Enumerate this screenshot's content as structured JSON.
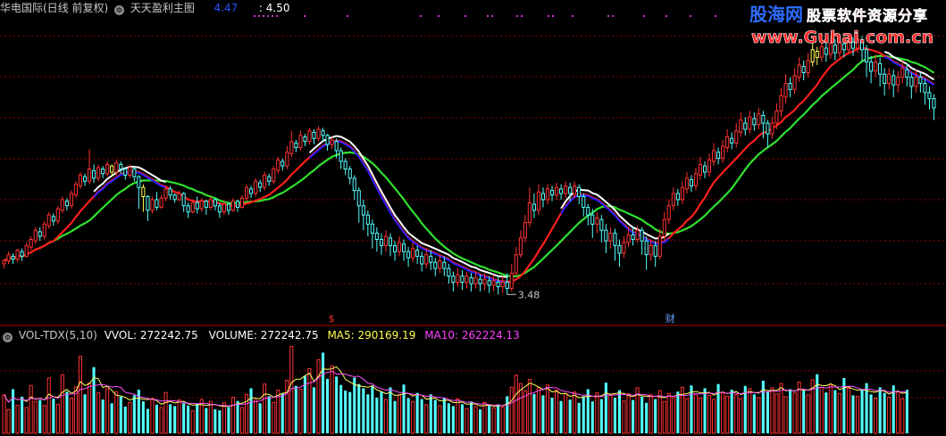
{
  "header": {
    "stock_title": "华电国际(日线 前复权)",
    "indicator_name": "天天盈利主图",
    "indicator_value_1": "4.47",
    "indicator_value_2": ": 4.50"
  },
  "volume_header": {
    "indicator_name": "VOL-TDX(5,10)",
    "vvol_text": "VVOL: 272242.75",
    "volume_text": "VOLUME: 272242.75",
    "ma5_text": "MA5: 290169.19",
    "ma10_text": "MA10: 262224.13"
  },
  "watermark": {
    "brand": "股海网",
    "slogan": "股票软件资源分享",
    "url": "www.Guhai.com.cn"
  },
  "colors": {
    "bull": "#ff3232",
    "bear": "#54ffff",
    "yellow_candle": "#ffff54",
    "line_red": "#ff1e1e",
    "line_green": "#30e030",
    "line_white": "#ffffff",
    "line_blue": "#2020ff",
    "ma5": "#ffff60",
    "ma10": "#ff50ff",
    "grid": "#8b0000",
    "dots": "#cc33cc"
  },
  "chart_data": {
    "type": "candlestick",
    "symbol": "华电国际",
    "period": "日线",
    "adjust": "前复权",
    "annotations": [
      {
        "text": "3.48",
        "bar_index": 112,
        "price": 3.48
      },
      {
        "text": "$",
        "bar_index": 73
      },
      {
        "text": "财",
        "bar_index": 148
      }
    ],
    "candles": [
      [
        3.68,
        3.7,
        3.65,
        3.71
      ],
      [
        3.7,
        3.74,
        3.68,
        3.76
      ],
      [
        3.73,
        3.71,
        3.68,
        3.75
      ],
      [
        3.71,
        3.77,
        3.69,
        3.78
      ],
      [
        3.76,
        3.73,
        3.7,
        3.78
      ],
      [
        3.73,
        3.8,
        3.72,
        3.82
      ],
      [
        3.79,
        3.84,
        3.77,
        3.86
      ],
      [
        3.83,
        3.9,
        3.81,
        3.92
      ],
      [
        3.89,
        3.86,
        3.83,
        3.92
      ],
      [
        3.86,
        3.94,
        3.84,
        3.96
      ],
      [
        3.93,
        4.0,
        3.91,
        4.02
      ],
      [
        3.99,
        3.96,
        3.93,
        4.01
      ],
      [
        3.96,
        4.04,
        3.94,
        4.06
      ],
      [
        4.03,
        4.1,
        4.01,
        4.12
      ],
      [
        4.09,
        4.06,
        4.03,
        4.11
      ],
      [
        4.06,
        4.14,
        4.04,
        4.16
      ],
      [
        4.13,
        4.2,
        4.11,
        4.22
      ],
      [
        4.19,
        4.26,
        4.17,
        4.28
      ],
      [
        4.25,
        4.22,
        4.19,
        4.27
      ],
      [
        4.22,
        4.3,
        4.2,
        4.43
      ],
      [
        4.29,
        4.24,
        4.21,
        4.33
      ],
      [
        4.24,
        4.31,
        4.22,
        4.33
      ],
      [
        4.3,
        4.27,
        4.24,
        4.32
      ],
      [
        4.27,
        4.33,
        4.25,
        4.35
      ],
      [
        4.32,
        4.28,
        4.25,
        4.33
      ],
      [
        4.28,
        4.34,
        4.26,
        4.36
      ],
      [
        4.33,
        4.3,
        4.27,
        4.35
      ],
      [
        4.3,
        4.26,
        4.23,
        4.31
      ],
      [
        4.26,
        4.31,
        4.24,
        4.33
      ],
      [
        4.3,
        4.25,
        4.22,
        4.31
      ],
      [
        4.25,
        4.18,
        4.04,
        4.26
      ],
      [
        4.18,
        4.12,
        4.02,
        4.2
      ],
      [
        4.12,
        4.03,
        3.96,
        4.13
      ],
      [
        4.03,
        4.1,
        4.01,
        4.12
      ],
      [
        4.1,
        4.05,
        4.03,
        4.15
      ],
      [
        4.05,
        4.11,
        4.04,
        4.13
      ],
      [
        4.11,
        4.17,
        4.09,
        4.19
      ],
      [
        4.17,
        4.13,
        4.1,
        4.19
      ],
      [
        4.13,
        4.1,
        4.08,
        4.14
      ],
      [
        4.1,
        4.14,
        4.09,
        4.16
      ],
      [
        4.14,
        4.06,
        4.02,
        4.15
      ],
      [
        4.06,
        4.02,
        3.98,
        4.08
      ],
      [
        4.02,
        4.08,
        4.01,
        4.1
      ],
      [
        4.08,
        4.04,
        4.01,
        4.12
      ],
      [
        4.04,
        4.09,
        4.02,
        4.11
      ],
      [
        4.09,
        4.05,
        4.0,
        4.1
      ],
      [
        4.05,
        4.1,
        4.03,
        4.12
      ],
      [
        4.1,
        4.06,
        4.03,
        4.11
      ],
      [
        4.06,
        4.02,
        3.98,
        4.08
      ],
      [
        4.02,
        4.07,
        4.0,
        4.09
      ],
      [
        4.07,
        4.03,
        4.0,
        4.08
      ],
      [
        4.03,
        4.09,
        4.02,
        4.11
      ],
      [
        4.09,
        4.05,
        4.02,
        4.1
      ],
      [
        4.05,
        4.11,
        4.04,
        4.13
      ],
      [
        4.11,
        4.18,
        4.09,
        4.2
      ],
      [
        4.17,
        4.14,
        4.11,
        4.19
      ],
      [
        4.14,
        4.22,
        4.12,
        4.24
      ],
      [
        4.21,
        4.18,
        4.15,
        4.23
      ],
      [
        4.18,
        4.26,
        4.16,
        4.28
      ],
      [
        4.25,
        4.22,
        4.19,
        4.27
      ],
      [
        4.22,
        4.3,
        4.2,
        4.32
      ],
      [
        4.29,
        4.36,
        4.27,
        4.38
      ],
      [
        4.35,
        4.32,
        4.29,
        4.37
      ],
      [
        4.32,
        4.41,
        4.3,
        4.45
      ],
      [
        4.4,
        4.48,
        4.38,
        4.55
      ],
      [
        4.47,
        4.44,
        4.41,
        4.49
      ],
      [
        4.44,
        4.52,
        4.42,
        4.55
      ],
      [
        4.51,
        4.48,
        4.45,
        4.53
      ],
      [
        4.48,
        4.55,
        4.46,
        4.57
      ],
      [
        4.54,
        4.5,
        4.46,
        4.56
      ],
      [
        4.5,
        4.56,
        4.48,
        4.58
      ],
      [
        4.55,
        4.52,
        4.48,
        4.57
      ],
      [
        4.52,
        4.46,
        4.42,
        4.53
      ],
      [
        4.46,
        4.49,
        4.43,
        4.51
      ],
      [
        4.48,
        4.42,
        4.37,
        4.5
      ],
      [
        4.42,
        4.35,
        4.3,
        4.44
      ],
      [
        4.35,
        4.3,
        4.26,
        4.37
      ],
      [
        4.3,
        4.24,
        4.2,
        4.32
      ],
      [
        4.24,
        4.16,
        4.1,
        4.26
      ],
      [
        4.16,
        4.06,
        3.95,
        4.18
      ],
      [
        4.06,
        4.0,
        3.9,
        4.1
      ],
      [
        4.0,
        3.94,
        3.86,
        4.03
      ],
      [
        3.94,
        3.88,
        3.78,
        3.97
      ],
      [
        3.88,
        3.84,
        3.76,
        3.92
      ],
      [
        3.84,
        3.8,
        3.74,
        3.88
      ],
      [
        3.8,
        3.86,
        3.76,
        3.9
      ],
      [
        3.85,
        3.8,
        3.73,
        3.88
      ],
      [
        3.8,
        3.76,
        3.7,
        3.83
      ],
      [
        3.76,
        3.82,
        3.73,
        3.86
      ],
      [
        3.81,
        3.76,
        3.7,
        3.84
      ],
      [
        3.76,
        3.72,
        3.66,
        3.79
      ],
      [
        3.72,
        3.78,
        3.69,
        3.82
      ],
      [
        3.77,
        3.73,
        3.68,
        3.8
      ],
      [
        3.73,
        3.68,
        3.63,
        3.76
      ],
      [
        3.68,
        3.74,
        3.65,
        3.78
      ],
      [
        3.73,
        3.69,
        3.64,
        3.77
      ],
      [
        3.69,
        3.65,
        3.6,
        3.72
      ],
      [
        3.65,
        3.7,
        3.62,
        3.74
      ],
      [
        3.69,
        3.65,
        3.6,
        3.73
      ],
      [
        3.65,
        3.6,
        3.55,
        3.68
      ],
      [
        3.6,
        3.56,
        3.5,
        3.63
      ],
      [
        3.56,
        3.61,
        3.53,
        3.65
      ],
      [
        3.6,
        3.56,
        3.51,
        3.64
      ],
      [
        3.56,
        3.6,
        3.52,
        3.63
      ],
      [
        3.59,
        3.55,
        3.5,
        3.62
      ],
      [
        3.55,
        3.59,
        3.52,
        3.63
      ],
      [
        3.58,
        3.55,
        3.5,
        3.61
      ],
      [
        3.55,
        3.58,
        3.51,
        3.62
      ],
      [
        3.57,
        3.54,
        3.49,
        3.6
      ],
      [
        3.54,
        3.57,
        3.5,
        3.61
      ],
      [
        3.56,
        3.53,
        3.48,
        3.6
      ],
      [
        3.53,
        3.56,
        3.49,
        3.6
      ],
      [
        3.56,
        3.52,
        3.48,
        3.62
      ],
      [
        3.52,
        3.62,
        3.5,
        3.68
      ],
      [
        3.62,
        3.74,
        3.6,
        3.79
      ],
      [
        3.74,
        3.85,
        3.72,
        3.9
      ],
      [
        3.85,
        3.95,
        3.82,
        4.0
      ],
      [
        3.95,
        4.08,
        3.92,
        4.18
      ],
      [
        4.07,
        4.03,
        3.98,
        4.14
      ],
      [
        4.03,
        4.15,
        4.0,
        4.2
      ],
      [
        4.14,
        4.1,
        4.05,
        4.18
      ],
      [
        4.1,
        4.17,
        4.07,
        4.2
      ],
      [
        4.16,
        4.13,
        4.09,
        4.19
      ],
      [
        4.13,
        4.18,
        4.1,
        4.21
      ],
      [
        4.17,
        4.14,
        4.1,
        4.2
      ],
      [
        4.14,
        4.19,
        4.11,
        4.22
      ],
      [
        4.18,
        4.14,
        4.09,
        4.21
      ],
      [
        4.14,
        4.19,
        4.11,
        4.22
      ],
      [
        4.18,
        4.12,
        4.07,
        4.2
      ],
      [
        4.12,
        4.05,
        3.99,
        4.14
      ],
      [
        4.05,
        4.0,
        3.93,
        4.07
      ],
      [
        4.0,
        3.94,
        3.85,
        4.04
      ],
      [
        3.94,
        3.98,
        3.88,
        4.02
      ],
      [
        3.97,
        3.9,
        3.82,
        4.0
      ],
      [
        3.9,
        3.83,
        3.75,
        3.94
      ],
      [
        3.83,
        3.88,
        3.78,
        3.92
      ],
      [
        3.88,
        3.8,
        3.7,
        3.91
      ],
      [
        3.8,
        3.75,
        3.66,
        3.84
      ],
      [
        3.75,
        3.82,
        3.72,
        3.86
      ],
      [
        3.82,
        3.87,
        3.79,
        3.92
      ],
      [
        3.87,
        3.84,
        3.8,
        3.92
      ],
      [
        3.84,
        3.9,
        3.82,
        3.93
      ],
      [
        3.9,
        3.83,
        3.74,
        3.92
      ],
      [
        3.83,
        3.74,
        3.64,
        3.86
      ],
      [
        3.74,
        3.8,
        3.7,
        3.84
      ],
      [
        3.8,
        3.73,
        3.66,
        3.83
      ],
      [
        3.73,
        3.86,
        3.71,
        3.91
      ],
      [
        3.86,
        3.97,
        3.83,
        4.02
      ],
      [
        3.97,
        4.06,
        3.94,
        4.1
      ],
      [
        4.06,
        4.14,
        4.03,
        4.18
      ],
      [
        4.14,
        4.1,
        4.06,
        4.17
      ],
      [
        4.1,
        4.18,
        4.07,
        4.22
      ],
      [
        4.17,
        4.24,
        4.14,
        4.28
      ],
      [
        4.23,
        4.19,
        4.15,
        4.26
      ],
      [
        4.19,
        4.27,
        4.16,
        4.31
      ],
      [
        4.26,
        4.33,
        4.23,
        4.38
      ],
      [
        4.32,
        4.28,
        4.24,
        4.35
      ],
      [
        4.28,
        4.36,
        4.25,
        4.4
      ],
      [
        4.35,
        4.42,
        4.32,
        4.47
      ],
      [
        4.41,
        4.37,
        4.33,
        4.44
      ],
      [
        4.37,
        4.45,
        4.34,
        4.49
      ],
      [
        4.44,
        4.51,
        4.41,
        4.56
      ],
      [
        4.5,
        4.47,
        4.43,
        4.54
      ],
      [
        4.47,
        4.55,
        4.44,
        4.6
      ],
      [
        4.54,
        4.62,
        4.51,
        4.67
      ],
      [
        4.6,
        4.56,
        4.52,
        4.64
      ],
      [
        4.56,
        4.64,
        4.53,
        4.68
      ],
      [
        4.63,
        4.59,
        4.55,
        4.67
      ],
      [
        4.59,
        4.66,
        4.56,
        4.7
      ],
      [
        4.65,
        4.6,
        4.5,
        4.68
      ],
      [
        4.6,
        4.53,
        4.44,
        4.62
      ],
      [
        4.53,
        4.6,
        4.5,
        4.64
      ],
      [
        4.6,
        4.68,
        4.56,
        4.73
      ],
      [
        4.68,
        4.78,
        4.64,
        4.83
      ],
      [
        4.77,
        4.86,
        4.73,
        4.92
      ],
      [
        4.86,
        4.82,
        4.77,
        4.9
      ],
      [
        4.82,
        4.91,
        4.79,
        4.96
      ],
      [
        4.9,
        4.98,
        4.87,
        5.03
      ],
      [
        4.97,
        4.93,
        4.88,
        5.01
      ],
      [
        4.93,
        5.01,
        4.9,
        5.06
      ],
      [
        5.0,
        5.08,
        4.97,
        5.13
      ],
      [
        5.07,
        5.03,
        4.98,
        5.1
      ],
      [
        5.03,
        5.1,
        5.0,
        5.14
      ],
      [
        5.09,
        5.05,
        5.0,
        5.13
      ],
      [
        5.05,
        5.12,
        5.02,
        5.17
      ],
      [
        5.11,
        5.06,
        5.01,
        5.15
      ],
      [
        5.06,
        5.13,
        5.03,
        5.17
      ],
      [
        5.12,
        5.08,
        5.03,
        5.15
      ],
      [
        5.08,
        5.14,
        5.05,
        5.18
      ],
      [
        5.13,
        5.09,
        5.04,
        5.16
      ],
      [
        5.09,
        5.15,
        5.06,
        5.19
      ],
      [
        5.14,
        5.08,
        5.0,
        5.17
      ],
      [
        5.08,
        5.0,
        4.9,
        5.11
      ],
      [
        5.0,
        4.94,
        4.86,
        5.04
      ],
      [
        4.94,
        5.0,
        4.9,
        5.05
      ],
      [
        4.99,
        4.92,
        4.84,
        5.03
      ],
      [
        4.92,
        4.86,
        4.78,
        4.96
      ],
      [
        4.86,
        4.92,
        4.82,
        4.96
      ],
      [
        4.91,
        4.85,
        4.77,
        4.95
      ],
      [
        4.85,
        4.9,
        4.8,
        4.94
      ],
      [
        4.9,
        4.96,
        4.86,
        5.01
      ],
      [
        4.95,
        4.9,
        4.84,
        4.99
      ],
      [
        4.9,
        4.84,
        4.76,
        4.93
      ],
      [
        4.84,
        4.9,
        4.8,
        4.95
      ],
      [
        4.9,
        4.86,
        4.8,
        4.93
      ],
      [
        4.86,
        4.8,
        4.72,
        4.89
      ],
      [
        4.8,
        4.76,
        4.69,
        4.84
      ],
      [
        4.76,
        4.7,
        4.62,
        4.79
      ]
    ],
    "volume": [
      8.2,
      5.1,
      9.4,
      6.0,
      7.8,
      5.5,
      10.2,
      6.8,
      7.1,
      5.9,
      11.8,
      7.4,
      6.2,
      12.5,
      8.9,
      7.5,
      9.9,
      16.4,
      8.3,
      10.7,
      14.1,
      8.6,
      7.2,
      9.5,
      6.4,
      8.9,
      7.8,
      5.7,
      6.6,
      8.1,
      9.3,
      6.8,
      5.2,
      7.4,
      6.1,
      5.5,
      8.7,
      6.2,
      5.8,
      7.1,
      6.4,
      5.9,
      4.8,
      6.3,
      7.2,
      5.4,
      6.8,
      5.1,
      4.9,
      6.5,
      5.6,
      7.7,
      6.9,
      5.5,
      8.3,
      9.6,
      7.1,
      6.4,
      10.5,
      7.9,
      6.6,
      9.2,
      8.5,
      11.3,
      18.5,
      10.1,
      9.4,
      12.2,
      13.8,
      9.8,
      15.7,
      17.2,
      11.6,
      14.4,
      12.1,
      10.3,
      9.1,
      8.8,
      11.9,
      10.5,
      9.6,
      8.3,
      10.2,
      7.6,
      8.9,
      7.2,
      9.8,
      6.9,
      8.1,
      10.4,
      7.5,
      6.8,
      8.6,
      7.3,
      6.1,
      8.3,
      7.1,
      5.9,
      7.6,
      6.4,
      5.8,
      7.3,
      6.2,
      5.3,
      6.8,
      5.7,
      5.1,
      6.6,
      5.9,
      5.4,
      6.2,
      5.6,
      7.9,
      9.8,
      12.4,
      10.6,
      9.1,
      11.5,
      8.4,
      9.7,
      8.1,
      10.3,
      7.6,
      9.2,
      6.9,
      8.5,
      7.2,
      8.8,
      6.5,
      7.9,
      9.4,
      6.8,
      8.6,
      7.3,
      10.8,
      8.1,
      7.6,
      9.2,
      6.9,
      8.4,
      7.1,
      9.7,
      7.8,
      6.5,
      8.2,
      7.3,
      9.1,
      6.8,
      8.5,
      7.6,
      8.9,
      9.8,
      7.4,
      10.2,
      8.3,
      7.5,
      9.6,
      8.1,
      7.2,
      10.5,
      8.6,
      7.9,
      9.3,
      8.2,
      7.4,
      10.1,
      9.5,
      8.3,
      7.6,
      11.2,
      8.9,
      9.7,
      8.4,
      10.6,
      7.8,
      9.4,
      8.6,
      10.9,
      9.1,
      8.2,
      11.4,
      12.6,
      9.8,
      8.7,
      10.3,
      9.2,
      8.5,
      11.8,
      9.6,
      8.1,
      7.9,
      9.4,
      10.7,
      8.3,
      7.5,
      9.8,
      8.6,
      7.7,
      10.2,
      8.8,
      7.4,
      9.3
    ]
  }
}
